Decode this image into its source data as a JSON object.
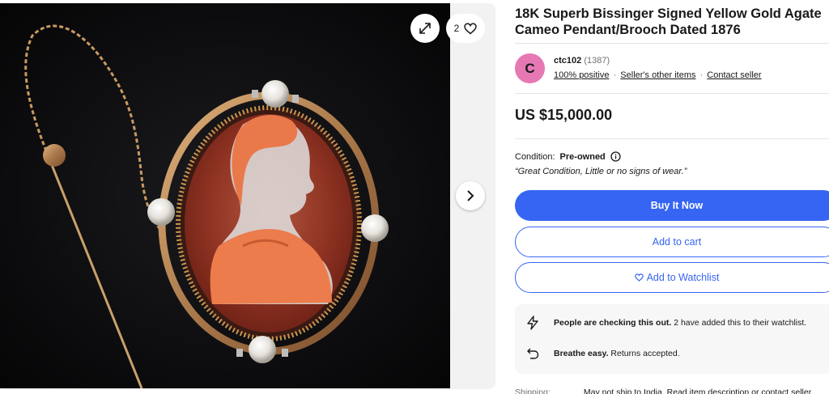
{
  "gallery": {
    "watch_count": "2",
    "icons": {
      "expand": "expand-icon",
      "heart": "heart-icon",
      "next": "chevron-right-icon"
    }
  },
  "listing": {
    "title": "18K Superb Bissinger Signed Yellow Gold Agate Cameo Pendant/Brooch Dated 1876"
  },
  "seller": {
    "avatar_letter": "C",
    "avatar_color": "#e678b4",
    "name": "ctc102",
    "feedback_count": "(1387)",
    "positive": "100% positive",
    "other_items": "Seller's other items",
    "contact": "Contact seller",
    "separator": "·"
  },
  "price": "US $15,000.00",
  "condition": {
    "label": "Condition:",
    "value": "Pre-owned",
    "description": "“Great Condition, Little or no signs of wear.”"
  },
  "actions": {
    "buy_now": "Buy It Now",
    "add_to_cart": "Add to cart",
    "add_to_watchlist": "Add to Watchlist",
    "primary_color": "#3665f3"
  },
  "promos": [
    {
      "icon": "lightning-icon",
      "bold": "People are checking this out.",
      "text": " 2 have added this to their watchlist."
    },
    {
      "icon": "return-arrow-icon",
      "bold": "Breathe easy.",
      "text": " Returns accepted."
    }
  ],
  "shipping": {
    "label": "Shipping:",
    "text": "May not ship to India. Read item description or contact seller"
  }
}
